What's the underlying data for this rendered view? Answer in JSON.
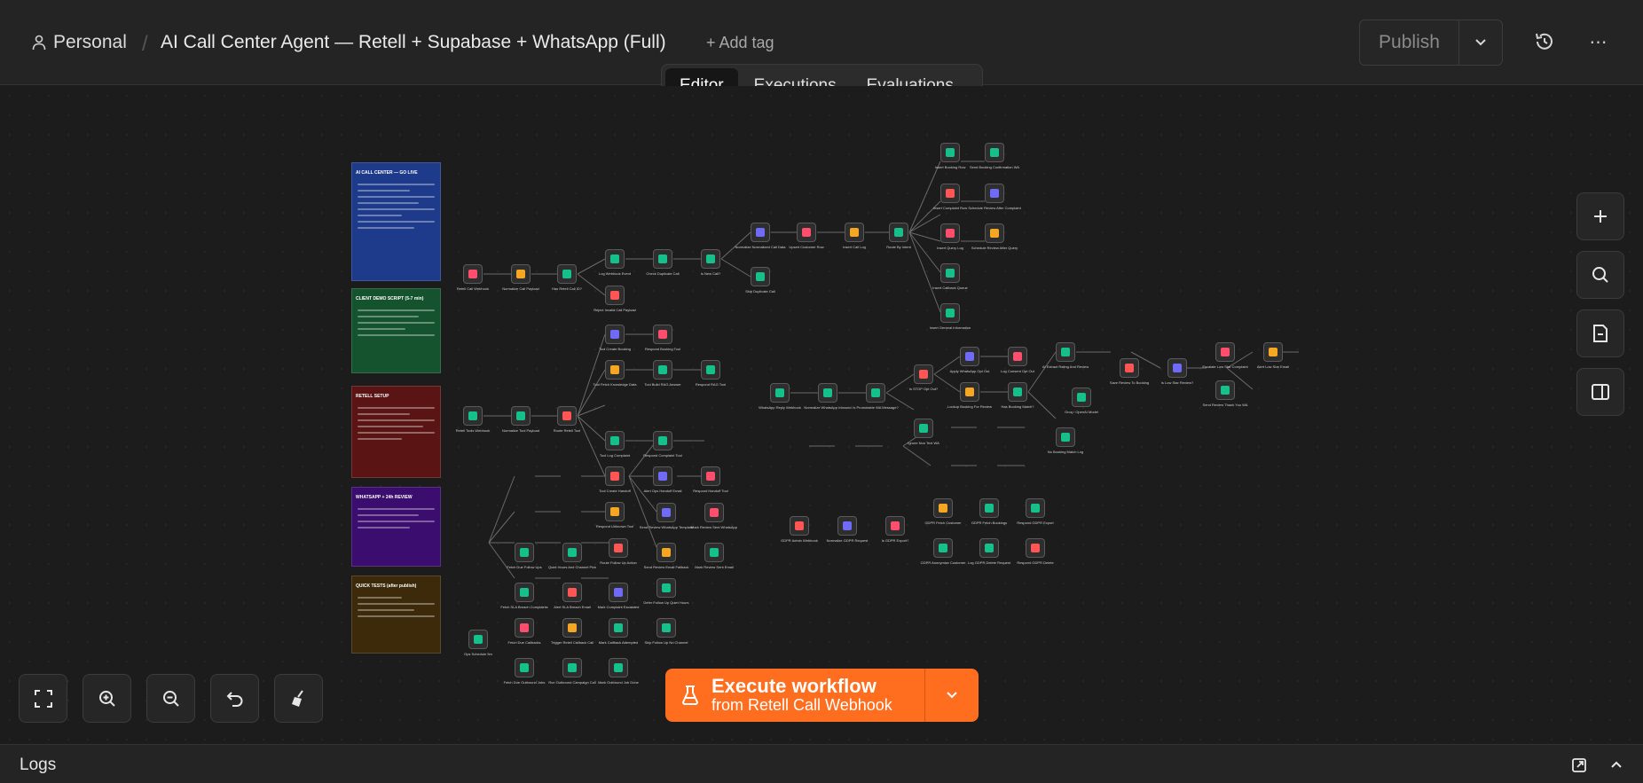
{
  "header": {
    "project": "Personal",
    "separator": "/",
    "workflow_title": "AI Call Center Agent — Retell + Supabase + WhatsApp (Full)",
    "add_tag": "+ Add tag",
    "publish": "Publish",
    "more": "⋯"
  },
  "tabs": [
    {
      "label": "Editor",
      "active": true
    },
    {
      "label": "Executions",
      "active": false
    },
    {
      "label": "Evaluations",
      "active": false
    }
  ],
  "execute": {
    "title": "Execute workflow",
    "sub_prefix": "from",
    "sub_node": "Retell Call Webhook"
  },
  "logs": {
    "label": "Logs"
  },
  "sticky_notes": [
    {
      "title": "AI CALL CENTER — GO LIVE",
      "color": "#1e3a8a"
    },
    {
      "title": "CLIENT DEMO SCRIPT (5-7 min)",
      "color": "#14532d"
    },
    {
      "title": "RETELL SETUP",
      "color": "#5b1414"
    },
    {
      "title": "WHATSAPP + 24h REVIEW",
      "color": "#3b0d6e"
    },
    {
      "title": "QUICK TESTS (after publish)",
      "color": "#3d2a0a"
    }
  ],
  "node_labels": [
    "Retell Call Webhook",
    "Normalize Call Payload",
    "Has Retell Call ID?",
    "Log Webhook Event",
    "Check Duplicate Call",
    "Is New Call?",
    "Reject Invalid Call Payload",
    "Normalize Normalized Call Data",
    "Upsert Customer Row",
    "Insert Call Log",
    "Route By Intent",
    "Skip Duplicate Call",
    "Insert Booking Row",
    "Send Booking Confirmation WA",
    "Insert Complaint Row",
    "Schedule Review After Complaint",
    "Insert Query Log",
    "Schedule Review After Query",
    "Insert Callback Queue",
    "Insert General Information",
    "Retell Tools Webhook",
    "Normalize Tool Payload",
    "Route Retell Tool",
    "Tool Create Booking",
    "Respond Booking Tool",
    "Tool Fetch Knowledge Data",
    "Tool Build RAG Answer",
    "Respond RAG Tool",
    "Tool Log Complaint",
    "Respond Complaint Tool",
    "Tool Create Handoff",
    "Alert Ops Handoff Email",
    "Respond Handoff Tool",
    "Respond Unknown Tool",
    "WhatsApp Reply Webhook",
    "Normalize WhatsApp Inbound",
    "Is Promotable WA Message?",
    "Ignore Non Text WA",
    "Is STOP Opt Out?",
    "Apply WhatsApp Opt Out",
    "Log Consent Opt Out",
    "Lookup Booking For Review",
    "Has Booking Match?",
    "AI Extract Rating And Review",
    "Groq / OpenAI Model",
    "No Booking Match Log",
    "Save Review To Booking",
    "Is Low Star Review?",
    "Escalate Low Star Complaint",
    "Alert Low Star Email",
    "Send Review Thank You WA",
    "Ops Schedule 5m",
    "Fetch Due Follow Ups",
    "Quiet Hours And Channel Pick",
    "Route Follow Up Action",
    "Send Review WhatsApp Template",
    "Mark Review Sent WhatsApp",
    "Send Review Email Fallback",
    "Mark Review Sent Email",
    "Defer Follow Up Quiet Hours",
    "Skip Follow Up No Channel",
    "Fetch SLA Breach Complaints",
    "Alert SLA Breach Email",
    "Mark Complaint Escalated",
    "Fetch Due Callbacks",
    "Trigger Retell Callback Call",
    "Mark Callback Attempted",
    "Fetch Due Outbound Jobs",
    "Run Outbound Campaign Call",
    "Mark Outbound Job Done",
    "GDPR Admin Webhook",
    "Normalize GDPR Request",
    "Is GDPR Export?",
    "GDPR Fetch Customer",
    "GDPR Fetch Bookings",
    "Respond GDPR Export",
    "GDPR Anonymize Customer",
    "Log GDPR Delete Request",
    "Respond GDPR Delete"
  ]
}
